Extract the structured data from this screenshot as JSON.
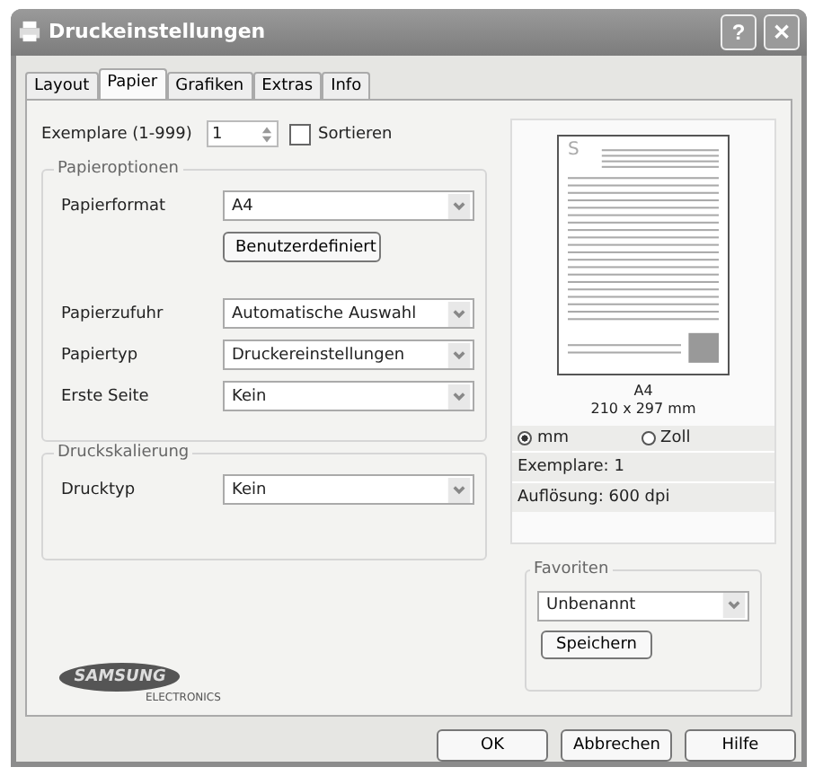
{
  "window": {
    "title": "Druckeinstellungen",
    "help_button": "?",
    "close_button": "✕"
  },
  "tabs": [
    {
      "label": "Layout",
      "selected": false
    },
    {
      "label": "Papier",
      "selected": true
    },
    {
      "label": "Grafiken",
      "selected": false
    },
    {
      "label": "Extras",
      "selected": false
    },
    {
      "label": "Info",
      "selected": false
    }
  ],
  "copies": {
    "label": "Exemplare (1-999)",
    "value": "1",
    "collate": {
      "label": "Sortieren",
      "checked": false
    }
  },
  "paper_options": {
    "title": "Papieroptionen",
    "fields": [
      {
        "kind": "select",
        "label": "Papierformat",
        "value": "A4"
      },
      {
        "kind": "button",
        "label": "Benutzerdefiniert"
      },
      {
        "kind": "select",
        "label": "Papierzufuhr",
        "value": "Automatische Auswahl"
      },
      {
        "kind": "select",
        "label": "Papiertyp",
        "value": "Druckereinstellungen"
      },
      {
        "kind": "select",
        "label": "Erste Seite",
        "value": "Kein"
      }
    ]
  },
  "scaling": {
    "title": "Druckskalierung",
    "fields": [
      {
        "kind": "select",
        "label": "Drucktyp",
        "value": "Kein"
      }
    ]
  },
  "preview": {
    "page_mark": "S",
    "format": "A4",
    "size": "210 x 297 mm",
    "units": [
      {
        "label": "mm",
        "selected": true
      },
      {
        "label": "Zoll",
        "selected": false
      }
    ],
    "copies": "Exemplare: 1",
    "resolution": "Auflösung: 600 dpi"
  },
  "favorites": {
    "title": "Favoriten",
    "value": "Unbenannt",
    "save_button": "Speichern"
  },
  "logo": {
    "brand": "SAMSUNG",
    "subtitle": "ELECTRONICS"
  },
  "buttons": [
    "OK",
    "Abbrechen",
    "Hilfe"
  ]
}
